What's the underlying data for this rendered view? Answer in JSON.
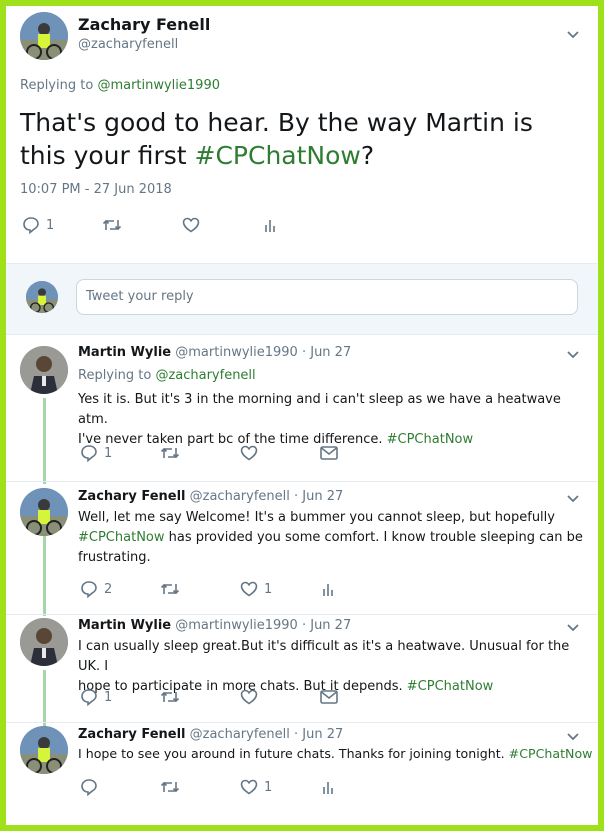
{
  "main_tweet": {
    "author_name": "Zachary Fenell",
    "author_handle": "@zacharyfenell",
    "replying_to_label": "Replying to ",
    "replying_to_handle": "@martinwylie1990",
    "text_part1": "That's good to hear. By the way Martin is this your first ",
    "hashtag": "#CPChatNow",
    "text_part2": "?",
    "timestamp": "10:07 PM - 27 Jun 2018",
    "reply_count": "1"
  },
  "reply_box": {
    "placeholder": "Tweet your reply"
  },
  "replies": [
    {
      "name": "Martin Wylie",
      "handle": "@martinwylie1990",
      "date": "· Jun 27",
      "replying_to_label": "Replying to ",
      "replying_to_handle": "@zacharyfenell",
      "text_line1": "Yes it is. But it's 3 in the morning and i can't sleep as we have a heatwave atm.",
      "text_line2_pre": "I've never taken part bc of the time difference. ",
      "hashtag": "#CPChatNow",
      "reply_count": "1"
    },
    {
      "name": "Zachary Fenell",
      "handle": "@zacharyfenell",
      "date": "· Jun 27",
      "text_line1": "Well, let me say Welcome! It's a bummer you cannot sleep, but hopefully",
      "hashtag": "#CPChatNow",
      "text_line2_post": " has provided you some comfort. I know trouble sleeping can be",
      "text_line3": "frustrating.",
      "reply_count": "2",
      "like_count": "1"
    },
    {
      "name": "Martin Wylie",
      "handle": "@martinwylie1990",
      "date": "· Jun 27",
      "text_line1": "I can usually sleep great.But it's difficult as it's a heatwave. Unusual for the UK. I",
      "text_line2_pre": "hope to participate in more chats. But it depends. ",
      "hashtag": "#CPChatNow",
      "reply_count": "1"
    },
    {
      "name": "Zachary Fenell",
      "handle": "@zacharyfenell",
      "date": "· Jun 27",
      "text_line1_pre": "I hope to see you around in future chats. Thanks for joining tonight. ",
      "hashtag": "#CPChatNow",
      "like_count": "1"
    }
  ],
  "icons": {
    "reply": "reply-icon",
    "retweet": "retweet-icon",
    "like": "heart-icon",
    "analytics": "analytics-icon",
    "message": "envelope-icon",
    "more": "chevron-down-icon"
  },
  "colors": {
    "frame": "#9ee01a",
    "hashtag": "#2e7d32",
    "thread_line": "#a5d6a7"
  }
}
